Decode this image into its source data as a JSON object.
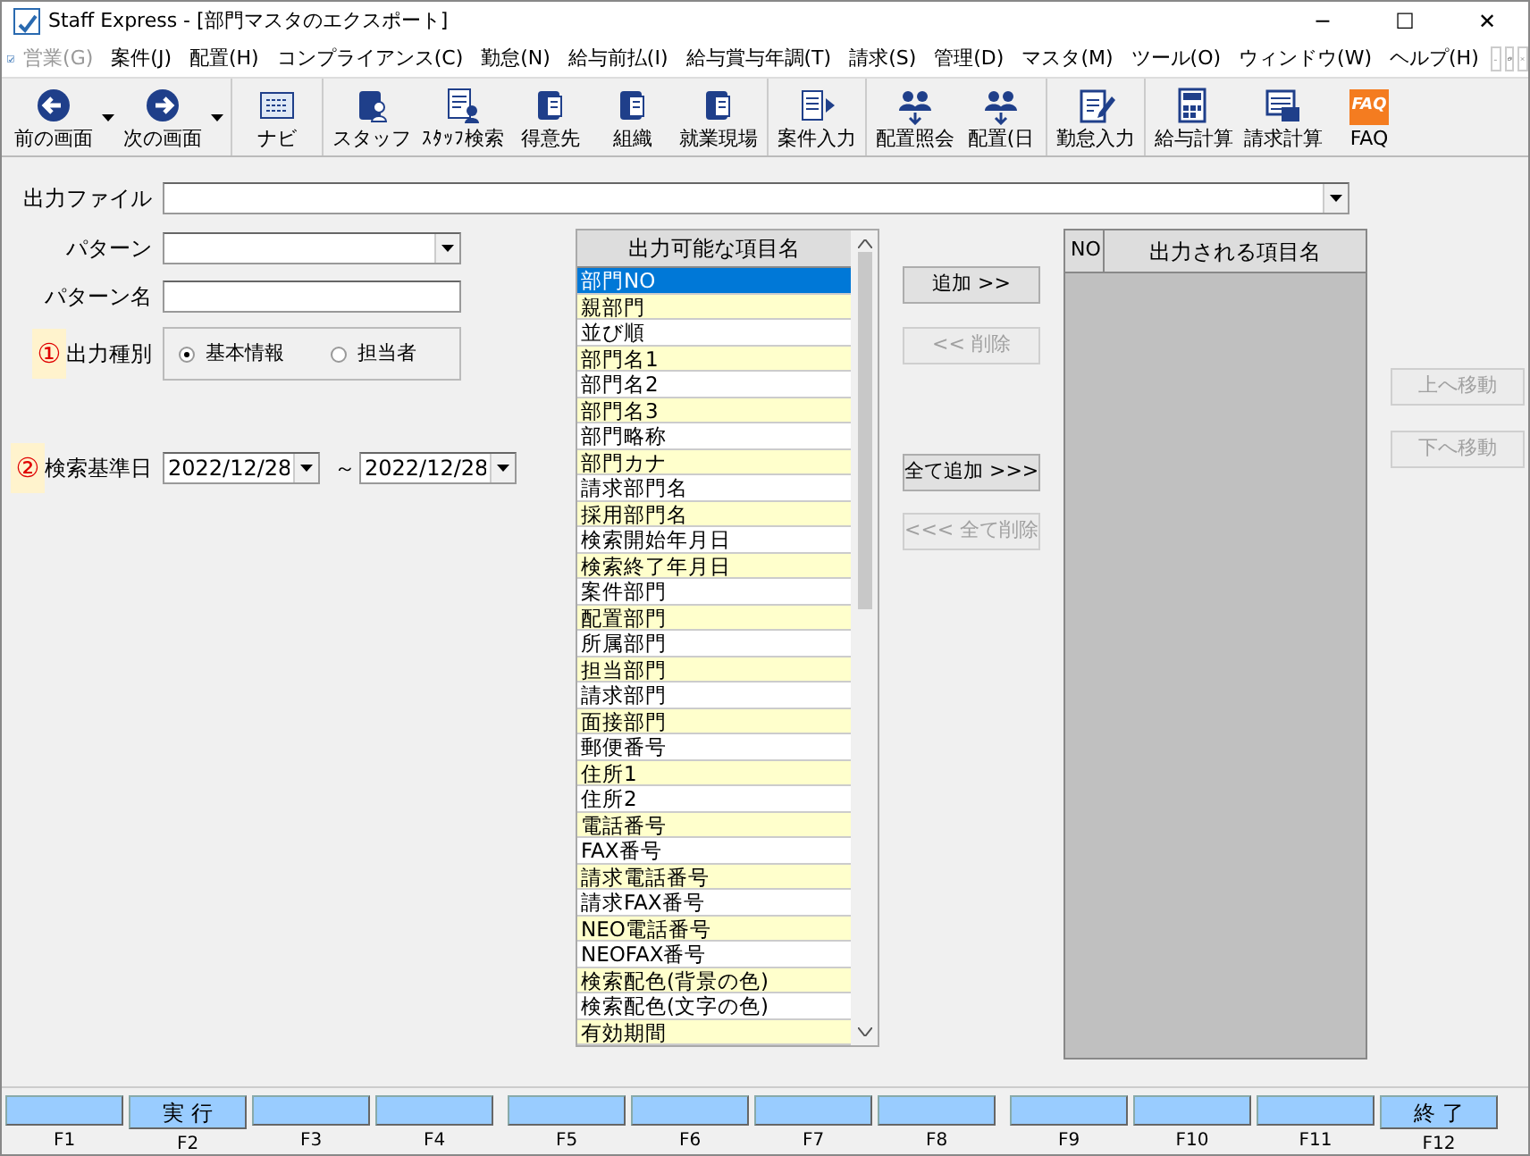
{
  "window": {
    "title": "Staff Express - [部門マスタのエクスポート]",
    "controls": [
      "─",
      "☐",
      "✕"
    ]
  },
  "menu": [
    {
      "label": "営業(G)",
      "disabled": true
    },
    {
      "label": "案件(J)",
      "disabled": false
    },
    {
      "label": "配置(H)",
      "disabled": false
    },
    {
      "label": "コンプライアンス(C)",
      "disabled": false
    },
    {
      "label": "勤怠(N)",
      "disabled": false
    },
    {
      "label": "給与前払(I)",
      "disabled": false
    },
    {
      "label": "給与賞与年調(T)",
      "disabled": false
    },
    {
      "label": "請求(S)",
      "disabled": false
    },
    {
      "label": "管理(D)",
      "disabled": false
    },
    {
      "label": "マスタ(M)",
      "disabled": false
    },
    {
      "label": "ツール(O)",
      "disabled": false
    },
    {
      "label": "ウィンドウ(W)",
      "disabled": false
    },
    {
      "label": "ヘルプ(H)",
      "disabled": false
    }
  ],
  "toolbar": [
    [
      {
        "label": "前の画面",
        "kind": "back",
        "dropdown": true
      },
      {
        "label": "次の画面",
        "kind": "forward",
        "dropdown": true
      }
    ],
    [
      {
        "label": "ナビ",
        "kind": "navi"
      }
    ],
    [
      {
        "label": "スタッフ",
        "kind": "staff"
      },
      {
        "label": "ｽﾀｯﾌ検索",
        "kind": "staff-search"
      },
      {
        "label": "得意先",
        "kind": "book"
      },
      {
        "label": "組織",
        "kind": "book"
      },
      {
        "label": "就業現場",
        "kind": "book"
      }
    ],
    [
      {
        "label": "案件入力",
        "kind": "case"
      }
    ],
    [
      {
        "label": "配置照会",
        "kind": "people"
      },
      {
        "label": "配置(日",
        "kind": "people"
      }
    ],
    [
      {
        "label": "勤怠入力",
        "kind": "attendance"
      }
    ],
    [
      {
        "label": "給与計算",
        "kind": "calc"
      },
      {
        "label": "請求計算",
        "kind": "calc2"
      },
      {
        "label": "FAQ",
        "kind": "faq",
        "badge": "FAQ"
      }
    ]
  ],
  "form": {
    "output_file": {
      "label": "出力ファイル"
    },
    "pattern": {
      "label": "パターン"
    },
    "pattern_name": {
      "label": "パターン名"
    },
    "output_type": {
      "marker": "①",
      "label": "出力種別",
      "options": [
        {
          "label": "基本情報",
          "selected": true
        },
        {
          "label": "担当者",
          "selected": false
        }
      ]
    },
    "search_date": {
      "marker": "②",
      "label": "検索基準日",
      "from": "2022/12/28",
      "separator": "～",
      "to": "2022/12/28"
    }
  },
  "available_list": {
    "header": "出力可能な項目名",
    "items": [
      {
        "label": "部門NO",
        "selected": true
      },
      {
        "label": "親部門",
        "selected": false
      },
      {
        "label": "並び順",
        "selected": false
      },
      {
        "label": "部門名1",
        "selected": false
      },
      {
        "label": "部門名2",
        "selected": false
      },
      {
        "label": "部門名3",
        "selected": false
      },
      {
        "label": "部門略称",
        "selected": false
      },
      {
        "label": "部門カナ",
        "selected": false
      },
      {
        "label": "請求部門名",
        "selected": false
      },
      {
        "label": "採用部門名",
        "selected": false
      },
      {
        "label": "検索開始年月日",
        "selected": false
      },
      {
        "label": "検索終了年月日",
        "selected": false
      },
      {
        "label": "案件部門",
        "selected": false
      },
      {
        "label": "配置部門",
        "selected": false
      },
      {
        "label": "所属部門",
        "selected": false
      },
      {
        "label": "担当部門",
        "selected": false
      },
      {
        "label": "請求部門",
        "selected": false
      },
      {
        "label": "面接部門",
        "selected": false
      },
      {
        "label": "郵便番号",
        "selected": false
      },
      {
        "label": "住所1",
        "selected": false
      },
      {
        "label": "住所2",
        "selected": false
      },
      {
        "label": "電話番号",
        "selected": false
      },
      {
        "label": "FAX番号",
        "selected": false
      },
      {
        "label": "請求電話番号",
        "selected": false
      },
      {
        "label": "請求FAX番号",
        "selected": false
      },
      {
        "label": "NEO電話番号",
        "selected": false
      },
      {
        "label": "NEOFAX番号",
        "selected": false
      },
      {
        "label": "検索配色(背景の色)",
        "selected": false
      },
      {
        "label": "検索配色(文字の色)",
        "selected": false
      },
      {
        "label": "有効期間",
        "selected": false
      }
    ]
  },
  "transfer_buttons": [
    {
      "label": "追加 >>",
      "disabled": false
    },
    {
      "label": "<< 削除",
      "disabled": true
    },
    {
      "label": "全て追加 >>>",
      "disabled": false
    },
    {
      "label": "<<< 全て削除",
      "disabled": true
    }
  ],
  "output_list": {
    "columns": [
      "NO",
      "出力される項目名"
    ]
  },
  "move_buttons": [
    {
      "label": "上へ移動",
      "disabled": true
    },
    {
      "label": "下へ移動",
      "disabled": true
    }
  ],
  "function_keys": [
    {
      "key": "F1"
    },
    {
      "label": "実 行",
      "key": "F2"
    },
    {
      "key": "F3"
    },
    {
      "key": "F4"
    },
    {
      "key": "F5"
    },
    {
      "key": "F6"
    },
    {
      "key": "F7"
    },
    {
      "key": "F8"
    },
    {
      "key": "F9"
    },
    {
      "key": "F10"
    },
    {
      "key": "F11"
    },
    {
      "label": "終 了",
      "key": "F12"
    }
  ]
}
